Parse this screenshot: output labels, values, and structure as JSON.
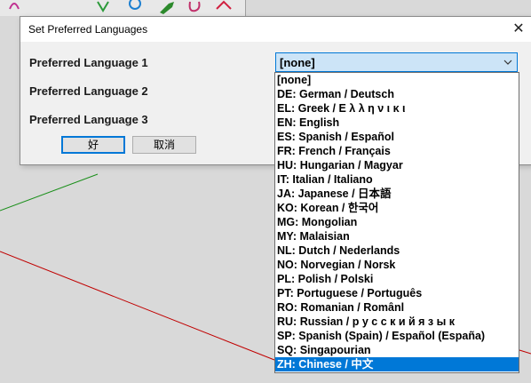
{
  "dialog": {
    "title": "Set Preferred Languages",
    "close_glyph": "✕",
    "labels": [
      "Preferred Language 1",
      "Preferred Language 2",
      "Preferred Language 3"
    ],
    "select_value": "[none]",
    "ok_label": "好",
    "cancel_label": "取消"
  },
  "dropdown": {
    "options": [
      "[none]",
      "DE: German / Deutsch",
      "EL: Greek / Ε λ λ η ν ι κ ι",
      "EN: English",
      "ES: Spanish / Español",
      "FR: French / Français",
      "HU: Hungarian / Magyar",
      "IT: Italian / Italiano",
      "JA: Japanese / 日本語",
      "KO: Korean / 한국어",
      "MG: Mongolian",
      "MY: Malaisian",
      "NL: Dutch / Nederlands",
      "NO: Norvegian / Norsk",
      "PL: Polish / Polski",
      "PT: Portuguese / Português",
      "RO: Romanian / Românl",
      "RU: Russian / р у с с к и й я з ы к",
      "SP: Spanish (Spain) / Español (España)",
      "SQ: Singapourian",
      "ZH: Chinese / 中文"
    ],
    "selected_index": 20
  },
  "colors": {
    "accent": "#0078d7",
    "select_bg": "#cce4f7",
    "canvas_red_line": "#c00000",
    "canvas_green_line": "#1a8f1a"
  },
  "toolbar": {
    "icons": [
      "curve-tool-icon",
      "polygon-tool-icon",
      "paint-bucket-icon",
      "rotate-tool-icon",
      "follow-me-icon"
    ]
  }
}
